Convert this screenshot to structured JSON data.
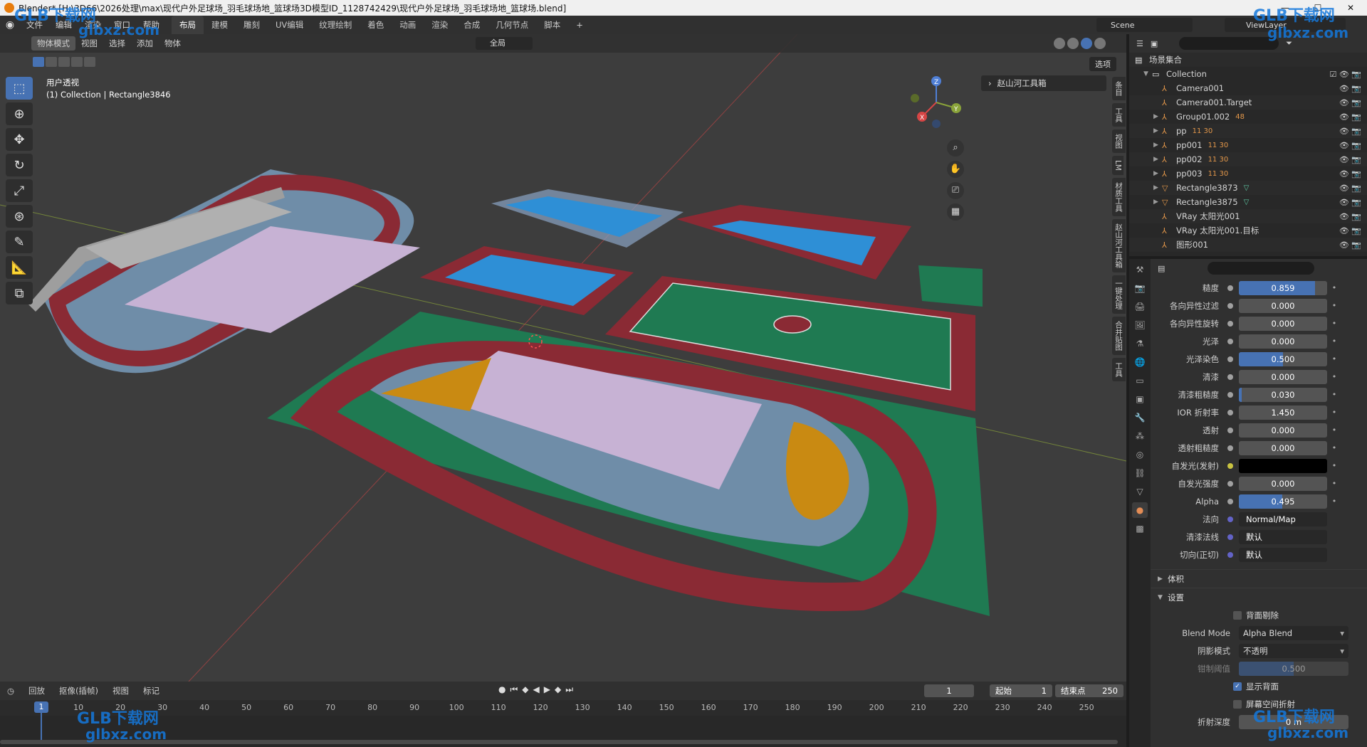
{
  "window": {
    "title": "Blender* [H:\\3D66\\2026处理\\max\\现代户外足球场_羽毛球场地_篮球场3D模型ID_1128742429\\现代户外足球场_羽毛球场地_篮球场.blend]",
    "minimize": "—",
    "maximize": "☐",
    "close": "✕"
  },
  "menu": [
    "文件",
    "编辑",
    "渲染",
    "窗口",
    "帮助"
  ],
  "workspaces": [
    "布局",
    "建模",
    "雕刻",
    "UV编辑",
    "纹理绘制",
    "着色",
    "动画",
    "渲染",
    "合成",
    "几何节点",
    "脚本"
  ],
  "active_workspace": "布局",
  "add_workspace": "+",
  "scene": "Scene",
  "view_layer": "ViewLayer",
  "viewport": {
    "mode": "物体模式",
    "menus": [
      "视图",
      "选择",
      "添加",
      "物体"
    ],
    "orientation": "全局",
    "options": "选项",
    "view_name": "用户透视",
    "collection_info": "(1) Collection | Rectangle3846",
    "addon_panel": "赵山河工具箱",
    "n_tabs": [
      "条目",
      "工具",
      "视图",
      "LM",
      "材质工具",
      "赵山河工具箱",
      "一键处理",
      "合并贴图",
      "工具"
    ],
    "axis": {
      "x": "X",
      "y": "Y",
      "z": "Z"
    }
  },
  "outliner": {
    "root": "场景集合",
    "collection": "Collection",
    "items": [
      {
        "name": "Camera001",
        "badge": ""
      },
      {
        "name": "Camera001.Target",
        "badge": ""
      },
      {
        "name": "Group01.002",
        "badge": "48"
      },
      {
        "name": "pp",
        "badge": "11 30"
      },
      {
        "name": "pp001",
        "badge": "11 30"
      },
      {
        "name": "pp002",
        "badge": "11 30"
      },
      {
        "name": "pp003",
        "badge": "11 30"
      },
      {
        "name": "Rectangle3873",
        "badge": "▽"
      },
      {
        "name": "Rectangle3875",
        "badge": "▽"
      },
      {
        "name": "VRay 太阳光001",
        "badge": ""
      },
      {
        "name": "VRay 太阳光001.目标",
        "badge": ""
      },
      {
        "name": "图形001",
        "badge": ""
      }
    ]
  },
  "properties": {
    "rows": [
      {
        "label": "糙度",
        "value": "0.859",
        "fill": 0.859
      },
      {
        "label": "各向异性过滤",
        "value": "0.000",
        "fill": 0
      },
      {
        "label": "各向异性旋转",
        "value": "0.000",
        "fill": 0
      },
      {
        "label": "光泽",
        "value": "0.000",
        "fill": 0
      },
      {
        "label": "光泽染色",
        "value": "0.500",
        "fill": 0.5
      },
      {
        "label": "清漆",
        "value": "0.000",
        "fill": 0
      },
      {
        "label": "清漆粗糙度",
        "value": "0.030",
        "fill": 0.03
      },
      {
        "label": "IOR 折射率",
        "value": "1.450",
        "fill": 0
      },
      {
        "label": "透射",
        "value": "0.000",
        "fill": 0
      },
      {
        "label": "透射粗糙度",
        "value": "0.000",
        "fill": 0
      },
      {
        "label": "自发光(发射)",
        "value": "",
        "fill": 0
      },
      {
        "label": "自发光强度",
        "value": "0.000",
        "fill": 0
      },
      {
        "label": "Alpha",
        "value": "0.495",
        "fill": 0.495
      }
    ],
    "normal": {
      "label": "法向",
      "value": "Normal/Map"
    },
    "clearcoat_normal": {
      "label": "清漆法线",
      "value": "默认"
    },
    "tangent": {
      "label": "切向(正切)",
      "value": "默认"
    },
    "volume_section": "体积",
    "settings_section": "设置",
    "backface_culling": "背面剔除",
    "blend_mode_label": "Blend Mode",
    "blend_mode": "Alpha Blend",
    "shadow_mode_label": "阴影模式",
    "shadow_mode": "不透明",
    "clip_threshold_label": "钳制阈值",
    "clip_threshold": "0.500",
    "show_backface": "显示背面",
    "screen_refraction": "屏幕空间折射",
    "refraction_depth_label": "折射深度",
    "refraction_depth": "0 m"
  },
  "timeline": {
    "menus": [
      "回放",
      "抠像(插帧)",
      "视图",
      "标记"
    ],
    "current_frame": "1",
    "start_label": "起始",
    "start": "1",
    "end_label": "结束点",
    "end": "250",
    "ticks": [
      "1",
      "10",
      "20",
      "30",
      "40",
      "50",
      "60",
      "70",
      "80",
      "90",
      "100",
      "110",
      "120",
      "130",
      "140",
      "150",
      "160",
      "170",
      "180",
      "190",
      "200",
      "210",
      "220",
      "230",
      "240",
      "250"
    ]
  },
  "watermark": {
    "brand": "GLB下载网",
    "site": "glbxz.com"
  },
  "colors": {
    "accent": "#4772b3",
    "viewport_bg": "#3d3d3d",
    "track_red": "#8a2a34",
    "field_green": "#1f7a52",
    "court_blue": "#2e8fd6",
    "sand_orange": "#c98a12",
    "pitch_lilac": "#c7b2d4"
  }
}
